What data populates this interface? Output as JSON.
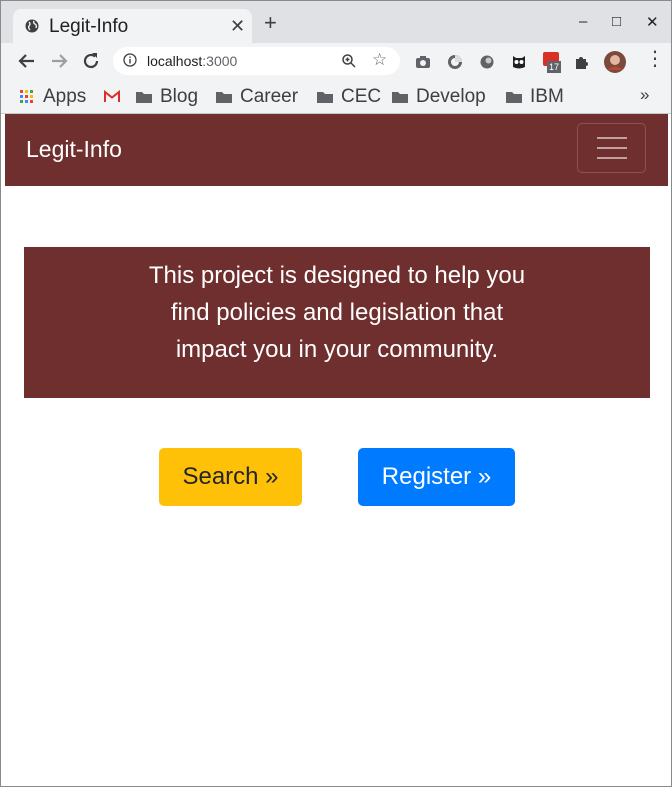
{
  "browser": {
    "tab": {
      "title": "Legit-Info",
      "close_symbol": "✕"
    },
    "new_tab_symbol": "+",
    "window_controls": {
      "minimize": "–",
      "maximize": "□",
      "close": "✕"
    },
    "url": {
      "host": "localhost",
      "port": ":3000"
    },
    "extensions": [
      "camera-icon",
      "color-wheel-icon",
      "circle-icon",
      "owl-icon",
      "calendar-icon",
      "puzzle-icon",
      "avatar"
    ],
    "calendar_badge": "17",
    "bookmarks": [
      "Apps",
      "Blog",
      "Career",
      "CEC",
      "Develop",
      "IBM"
    ],
    "bookmarks_more": "»"
  },
  "navbar": {
    "brand": "Legit-Info"
  },
  "jumbotron": {
    "lines": [
      "This project is designed to help you",
      "find policies and legislation that",
      "impact you in your community."
    ]
  },
  "buttons": {
    "search": "Search »",
    "register": "Register »"
  },
  "colors": {
    "maroon": "#6f2f2e",
    "warning": "#ffc107",
    "primary": "#007bff"
  }
}
